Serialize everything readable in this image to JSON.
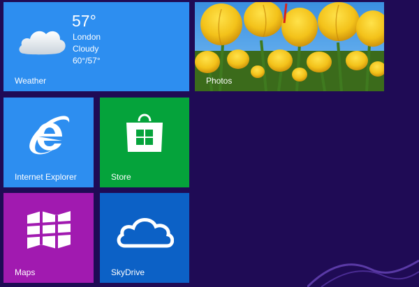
{
  "colors": {
    "background": "#1f0b55",
    "weather": "#2d8ef0",
    "photos_accent": "#c8112c",
    "ie": "#2d8ef0",
    "store": "#05a33b",
    "maps": "#a11ab0",
    "skydrive": "#0c61c6"
  },
  "tiles": {
    "weather": {
      "label": "Weather",
      "temperature": "57°",
      "location": "London",
      "condition": "Cloudy",
      "range": "60°/57°",
      "icon": "cloud-icon"
    },
    "photos": {
      "label": "Photos",
      "image": "yellow-tulips"
    },
    "ie": {
      "label": "Internet Explorer",
      "icon": "internet-explorer-icon"
    },
    "store": {
      "label": "Store",
      "icon": "store-bag-icon"
    },
    "maps": {
      "label": "Maps",
      "icon": "maps-icon"
    },
    "skydrive": {
      "label": "SkyDrive",
      "icon": "skydrive-cloud-icon"
    }
  }
}
